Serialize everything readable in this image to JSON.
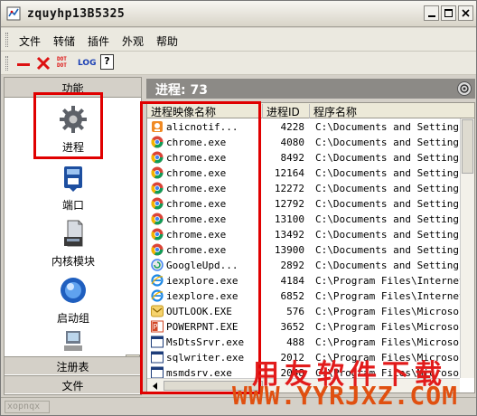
{
  "window": {
    "title": "zquyhp13B5325",
    "buttons": [
      "minimize",
      "maximize",
      "close"
    ]
  },
  "menu": {
    "items": [
      "文件",
      "转储",
      "插件",
      "外观",
      "帮助"
    ]
  },
  "toolbar": {
    "icons": [
      "minus-icon",
      "close-icon",
      "dot-icon",
      "log-icon",
      "help-icon"
    ],
    "dot_label_top": "DOT",
    "dot_label_bottom": "DOT",
    "log_label": "LOG",
    "help_label": "?"
  },
  "sidebar": {
    "header": "功能",
    "items": [
      {
        "label": "进程",
        "icon": "gear-icon",
        "selected": true
      },
      {
        "label": "端口",
        "icon": "network-icon"
      },
      {
        "label": "内核模块",
        "icon": "module-icon"
      },
      {
        "label": "启动组",
        "icon": "startup-icon"
      }
    ],
    "sections": [
      "注册表",
      "文件"
    ]
  },
  "process_panel": {
    "count_label": "进程: 73",
    "columns": [
      "进程映像名称",
      "进程ID",
      "程序名称"
    ],
    "rows": [
      {
        "name": "alicnotif...",
        "pid": "4228",
        "path": "C:\\Documents and Settings\\u",
        "icon": "app-icon"
      },
      {
        "name": "chrome.exe",
        "pid": "4080",
        "path": "C:\\Documents and Settings\\u",
        "icon": "chrome-icon"
      },
      {
        "name": "chrome.exe",
        "pid": "8492",
        "path": "C:\\Documents and Settings\\u",
        "icon": "chrome-icon"
      },
      {
        "name": "chrome.exe",
        "pid": "12164",
        "path": "C:\\Documents and Settings\\u",
        "icon": "chrome-icon"
      },
      {
        "name": "chrome.exe",
        "pid": "12272",
        "path": "C:\\Documents and Settings\\u",
        "icon": "chrome-icon"
      },
      {
        "name": "chrome.exe",
        "pid": "12792",
        "path": "C:\\Documents and Settings\\u",
        "icon": "chrome-icon"
      },
      {
        "name": "chrome.exe",
        "pid": "13100",
        "path": "C:\\Documents and Settings\\u",
        "icon": "chrome-icon"
      },
      {
        "name": "chrome.exe",
        "pid": "13492",
        "path": "C:\\Documents and Settings\\u",
        "icon": "chrome-icon"
      },
      {
        "name": "chrome.exe",
        "pid": "13900",
        "path": "C:\\Documents and Settings\\u",
        "icon": "chrome-icon"
      },
      {
        "name": "GoogleUpd...",
        "pid": "2892",
        "path": "C:\\Documents and Settings\\u",
        "icon": "google-update-icon"
      },
      {
        "name": "iexplore.exe",
        "pid": "4184",
        "path": "C:\\Program Files\\Internet I",
        "icon": "ie-icon"
      },
      {
        "name": "iexplore.exe",
        "pid": "6852",
        "path": "C:\\Program Files\\Internet I",
        "icon": "ie-icon"
      },
      {
        "name": "OUTLOOK.EXE",
        "pid": "576",
        "path": "C:\\Program Files\\Microsoft",
        "icon": "outlook-icon"
      },
      {
        "name": "POWERPNT.EXE",
        "pid": "3652",
        "path": "C:\\Program Files\\Microsoft",
        "icon": "powerpoint-icon"
      },
      {
        "name": "MsDtsSrvr.exe",
        "pid": "488",
        "path": "C:\\Program Files\\Microsoft",
        "icon": "window-icon"
      },
      {
        "name": "sqlwriter.exe",
        "pid": "2012",
        "path": "C:\\Program Files\\Microsoft",
        "icon": "window-icon"
      },
      {
        "name": "msmdsrv.exe",
        "pid": "2048",
        "path": "C:\\Program Files\\Microsoft",
        "icon": "window-icon"
      }
    ]
  },
  "status": {
    "text": "xopnqx"
  },
  "watermark": {
    "top": "用友软件下载",
    "bottom": "WWW.YYRJXZ.COM"
  }
}
